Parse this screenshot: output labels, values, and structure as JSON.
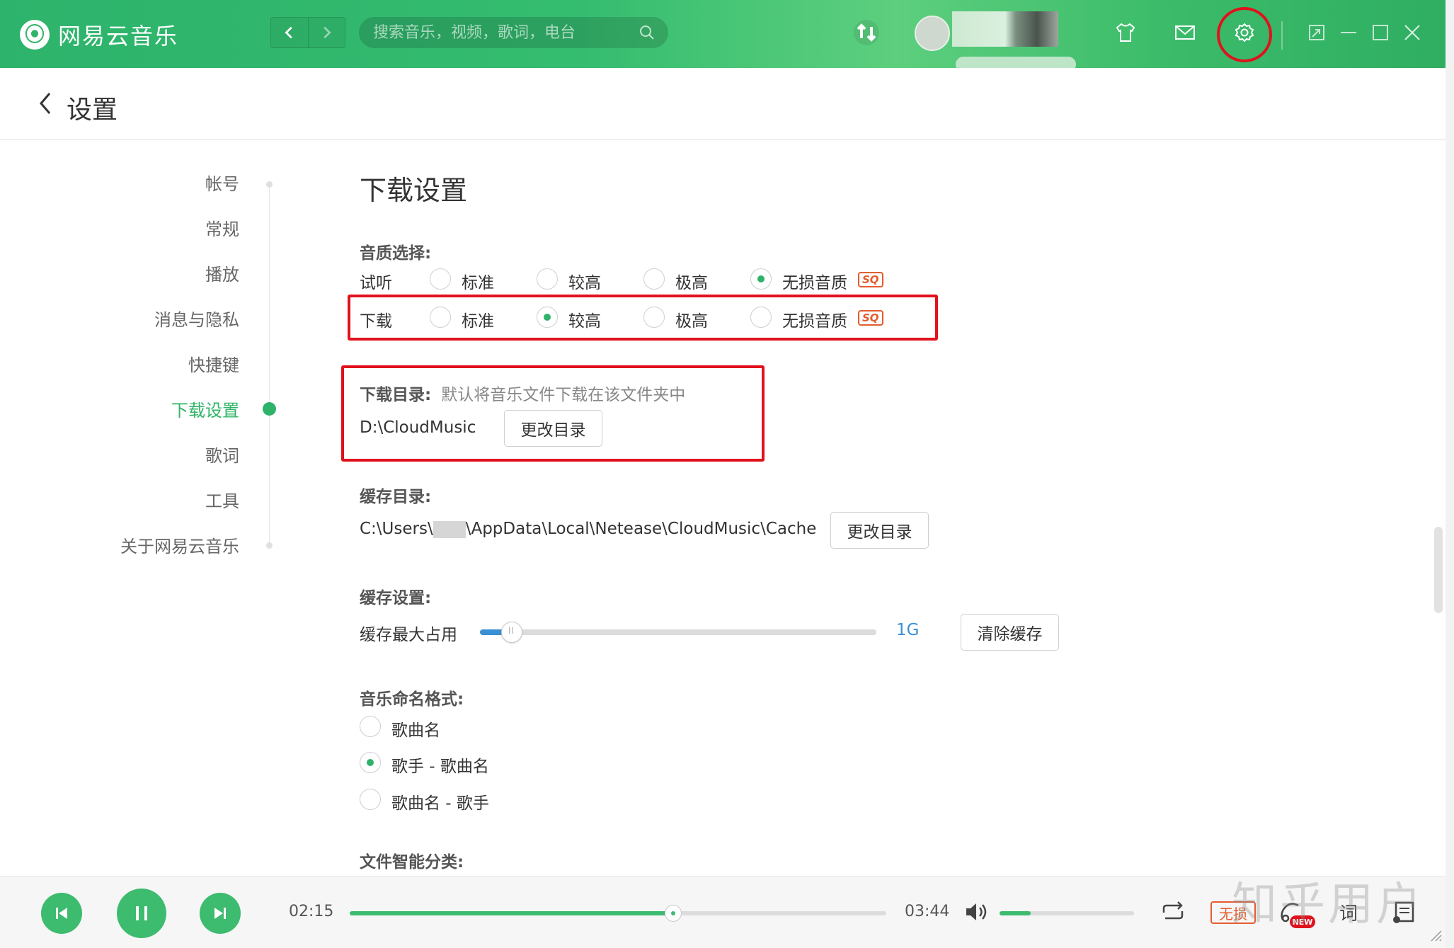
{
  "app": {
    "name": "网易云音乐",
    "logo_glyph": "⦿"
  },
  "titlebar": {
    "search_placeholder": "搜索音乐，视频，歌词，电台",
    "accent": "#31b468",
    "icons": [
      "back-icon",
      "forward-icon",
      "search-icon",
      "sync-icon",
      "skin-icon",
      "mail-icon",
      "settings-icon",
      "mini-mode-icon",
      "minimize-icon",
      "maximize-icon",
      "close-icon"
    ]
  },
  "header": {
    "title": "设置"
  },
  "sidebar": {
    "items": [
      {
        "label": "帐号"
      },
      {
        "label": "常规"
      },
      {
        "label": "播放"
      },
      {
        "label": "消息与隐私"
      },
      {
        "label": "快捷键"
      },
      {
        "label": "下载设置",
        "active": true
      },
      {
        "label": "歌词"
      },
      {
        "label": "工具"
      },
      {
        "label": "关于网易云音乐"
      }
    ]
  },
  "download_settings": {
    "title": "下载设置",
    "quality": {
      "label": "音质选择:",
      "sq_badge": "SQ",
      "listen": {
        "label": "试听",
        "options": [
          "标准",
          "较高",
          "极高",
          "无损音质"
        ],
        "selected": "无损音质"
      },
      "download": {
        "label": "下载",
        "options": [
          "标准",
          "较高",
          "极高",
          "无损音质"
        ],
        "selected": "较高"
      }
    },
    "download_dir": {
      "label": "下载目录:",
      "hint": "默认将音乐文件下载在该文件夹中",
      "path": "D:\\CloudMusic",
      "button": "更改目录"
    },
    "cache_dir": {
      "label": "缓存目录:",
      "path_prefix": "C:\\Users\\",
      "path_suffix": "\\AppData\\Local\\Netease\\CloudMusic\\Cache",
      "button": "更改目录"
    },
    "cache_settings": {
      "label": "缓存设置:",
      "max_label": "缓存最大占用",
      "value": "1G",
      "level_fraction": 0.08,
      "button": "清除缓存"
    },
    "naming": {
      "label": "音乐命名格式:",
      "options": [
        "歌曲名",
        "歌手 - 歌曲名",
        "歌曲名 - 歌手"
      ],
      "selected": "歌手 - 歌曲名"
    },
    "smart_classify": {
      "label": "文件智能分类:"
    }
  },
  "player": {
    "current_time": "02:15",
    "total_time": "03:44",
    "progress_fraction": 0.603,
    "volume_fraction": 0.23,
    "quality_label": "无损",
    "new_badge": "NEW",
    "lyric_label": "词"
  },
  "watermark": "知乎用户"
}
